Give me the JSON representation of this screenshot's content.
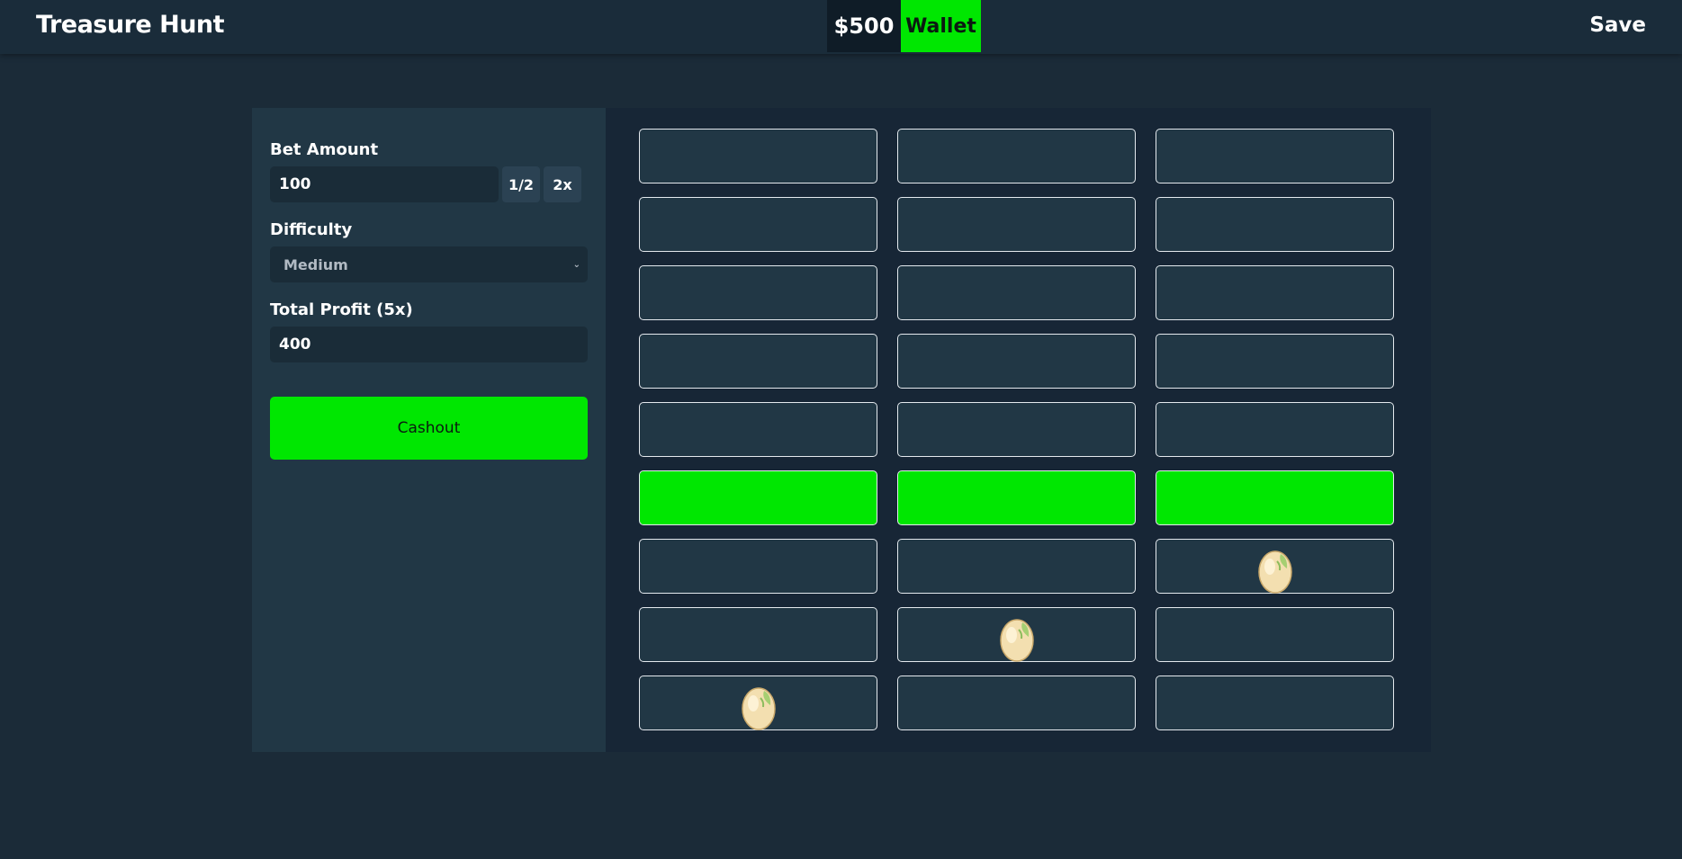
{
  "header": {
    "title": "Treasure Hunt",
    "balance": "$500",
    "wallet_label": "Wallet",
    "save_label": "Save"
  },
  "controls": {
    "bet_label": "Bet Amount",
    "bet_value": "100",
    "half_label": "1/2",
    "double_label": "2x",
    "difficulty_label": "Difficulty",
    "difficulty_value": "Medium",
    "profit_label": "Total Profit (5x)",
    "profit_value": "400",
    "cashout_label": "Cashout"
  },
  "colors": {
    "accent": "#00e701",
    "background": "#1b2b38",
    "panel": "#213745",
    "board": "#172636",
    "tile": "#213745"
  },
  "board": {
    "rows": [
      [
        "empty",
        "empty",
        "empty"
      ],
      [
        "empty",
        "empty",
        "empty"
      ],
      [
        "empty",
        "empty",
        "empty"
      ],
      [
        "empty",
        "empty",
        "empty"
      ],
      [
        "empty",
        "empty",
        "empty"
      ],
      [
        "active",
        "active",
        "active"
      ],
      [
        "empty",
        "empty",
        "egg-icon"
      ],
      [
        "empty",
        "egg-icon",
        "empty"
      ],
      [
        "egg-icon",
        "empty",
        "empty"
      ]
    ]
  }
}
